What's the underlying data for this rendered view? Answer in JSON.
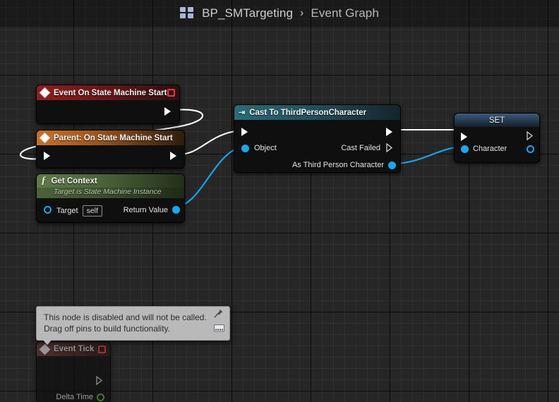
{
  "header": {
    "icon": "blueprint-grid-icon",
    "blueprint_name": "BP_SMTargeting",
    "separator": "›",
    "graph_name": "Event Graph"
  },
  "colors": {
    "canvas_bg": "#262626",
    "exec_wire": "#ffffff",
    "object_wire": "#1aa7f0",
    "event_header": "#8e1f1f",
    "parent_header": "#c6712a",
    "function_header": "#5f7a4a",
    "cast_header": "#2c6a77",
    "set_header": "#3d5a79",
    "delta_time_pin": "#62c12c",
    "event_pin_red": "#e33b3b"
  },
  "nodes": [
    {
      "id": "event-on-state-machine-start",
      "title": "Event On State Machine Start",
      "glyph": "event-diamond-icon",
      "badge": "event-delegate-pin",
      "out_exec": ""
    },
    {
      "id": "parent-on-state-machine-start",
      "title": "Parent: On State Machine Start",
      "glyph": "event-diamond-icon",
      "in_exec": "",
      "out_exec": ""
    },
    {
      "id": "get-context",
      "title": "Get Context",
      "subtitle": "Target is State Machine Instance",
      "glyph": "function-f-icon",
      "inputs": [
        {
          "label": "Target",
          "value": "self",
          "pin": "object-ref-pin"
        }
      ],
      "outputs": [
        {
          "label": "Return Value",
          "pin": "object-pin"
        }
      ]
    },
    {
      "id": "cast-to-third-person-character",
      "title": "Cast To ThirdPersonCharacter",
      "glyph": "cast-arrow-icon",
      "inputs": [
        {
          "label": "Object",
          "pin": "object-pin"
        }
      ],
      "outputs": [
        {
          "label": "Cast Failed",
          "pin": "exec-pin"
        },
        {
          "label": "As Third Person Character",
          "pin": "object-pin"
        }
      ]
    },
    {
      "id": "set-character",
      "title": "SET",
      "inputs": [
        {
          "label": "Character",
          "pin": "object-pin"
        }
      ],
      "outputs": [
        {
          "label": "",
          "pin": "object-pin"
        }
      ]
    },
    {
      "id": "event-tick",
      "title": "Event Tick",
      "glyph": "event-diamond-icon",
      "badge": "event-delegate-pin",
      "disabled": true,
      "outputs": [
        {
          "label": "Delta Time",
          "pin": "float-pin"
        }
      ]
    }
  ],
  "tooltip": {
    "line1": "This node is disabled and will not be called.",
    "line2": "Drag off pins to build functionality.",
    "icons": [
      "pin-thumbtack-icon",
      "keyboard-icon"
    ]
  }
}
